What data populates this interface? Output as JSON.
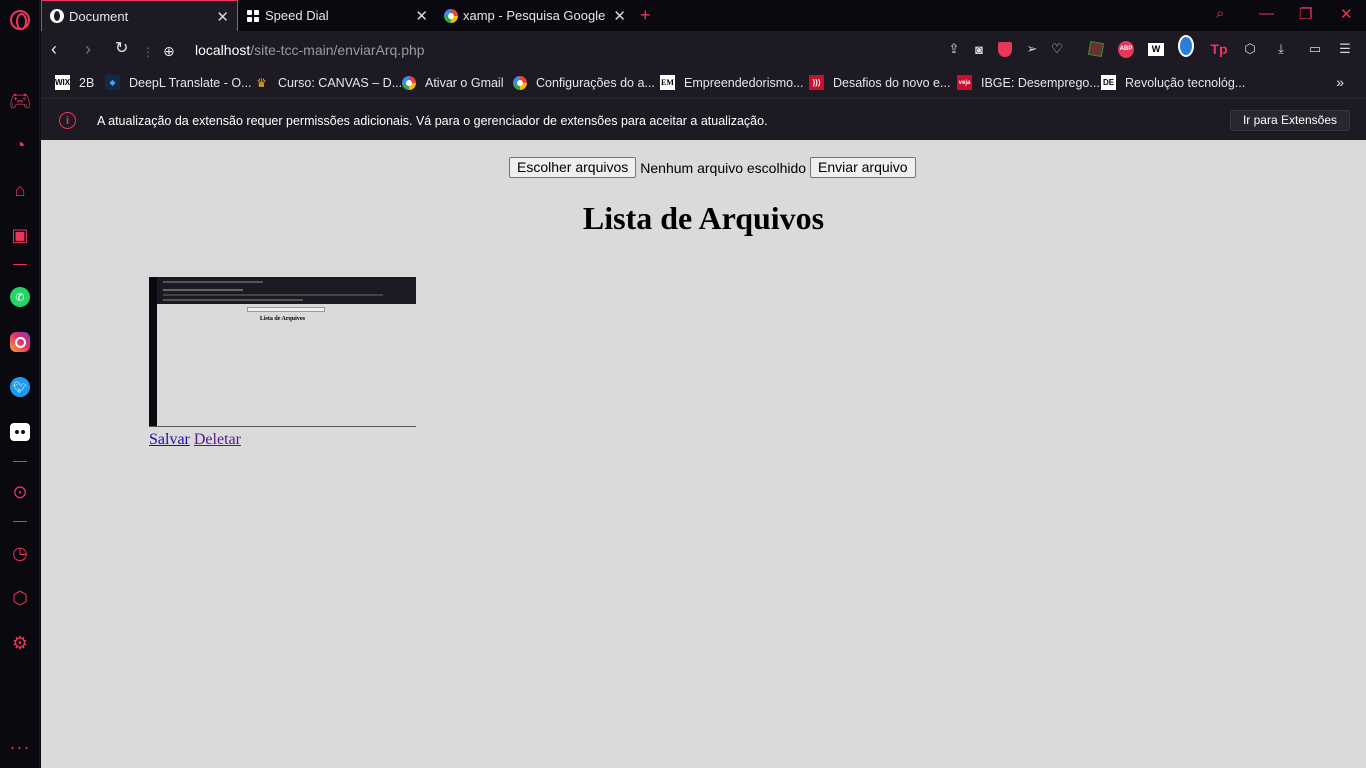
{
  "tabs": [
    {
      "title": "Document",
      "favicon": "globe-icon",
      "active": true
    },
    {
      "title": "Speed Dial",
      "favicon": "grid-icon",
      "active": false
    },
    {
      "title": "xamp - Pesquisa Google",
      "favicon": "google-icon",
      "active": false
    }
  ],
  "address": {
    "host": "localhost",
    "path": "/site-tcc-main/enviarArq.php"
  },
  "bookmarks": [
    {
      "label": "2B",
      "icon": "WIX"
    },
    {
      "label": "DeepL Translate - O...",
      "icon": "deepl"
    },
    {
      "label": "Curso: CANVAS – D...",
      "icon": "curso"
    },
    {
      "label": "Ativar o Gmail",
      "icon": "google"
    },
    {
      "label": "Configurações do a...",
      "icon": "google"
    },
    {
      "label": "Empreendedorismo...",
      "icon": "EM"
    },
    {
      "label": "Desafios do novo e...",
      "icon": "desafios"
    },
    {
      "label": "IBGE: Desemprego...",
      "icon": "veja"
    },
    {
      "label": "Revolução tecnológ...",
      "icon": "DE"
    }
  ],
  "notice": {
    "message": "A atualização da extensão requer permissões adicionais. Vá para o gerenciador de extensões para aceitar a atualização.",
    "button": "Ir para Extensões"
  },
  "page": {
    "choose_button": "Escolher arquivos",
    "no_file": "Nenhum arquivo escolhido",
    "submit_button": "Enviar arquivo",
    "heading": "Lista de Arquivos",
    "thumbnail_title": "Lista de Arquivos",
    "save_link": "Salvar",
    "delete_link": "Deletar"
  },
  "colors": {
    "accent": "#e8375a",
    "page_bg": "#dadada",
    "chrome_bg": "#1d1a23"
  }
}
